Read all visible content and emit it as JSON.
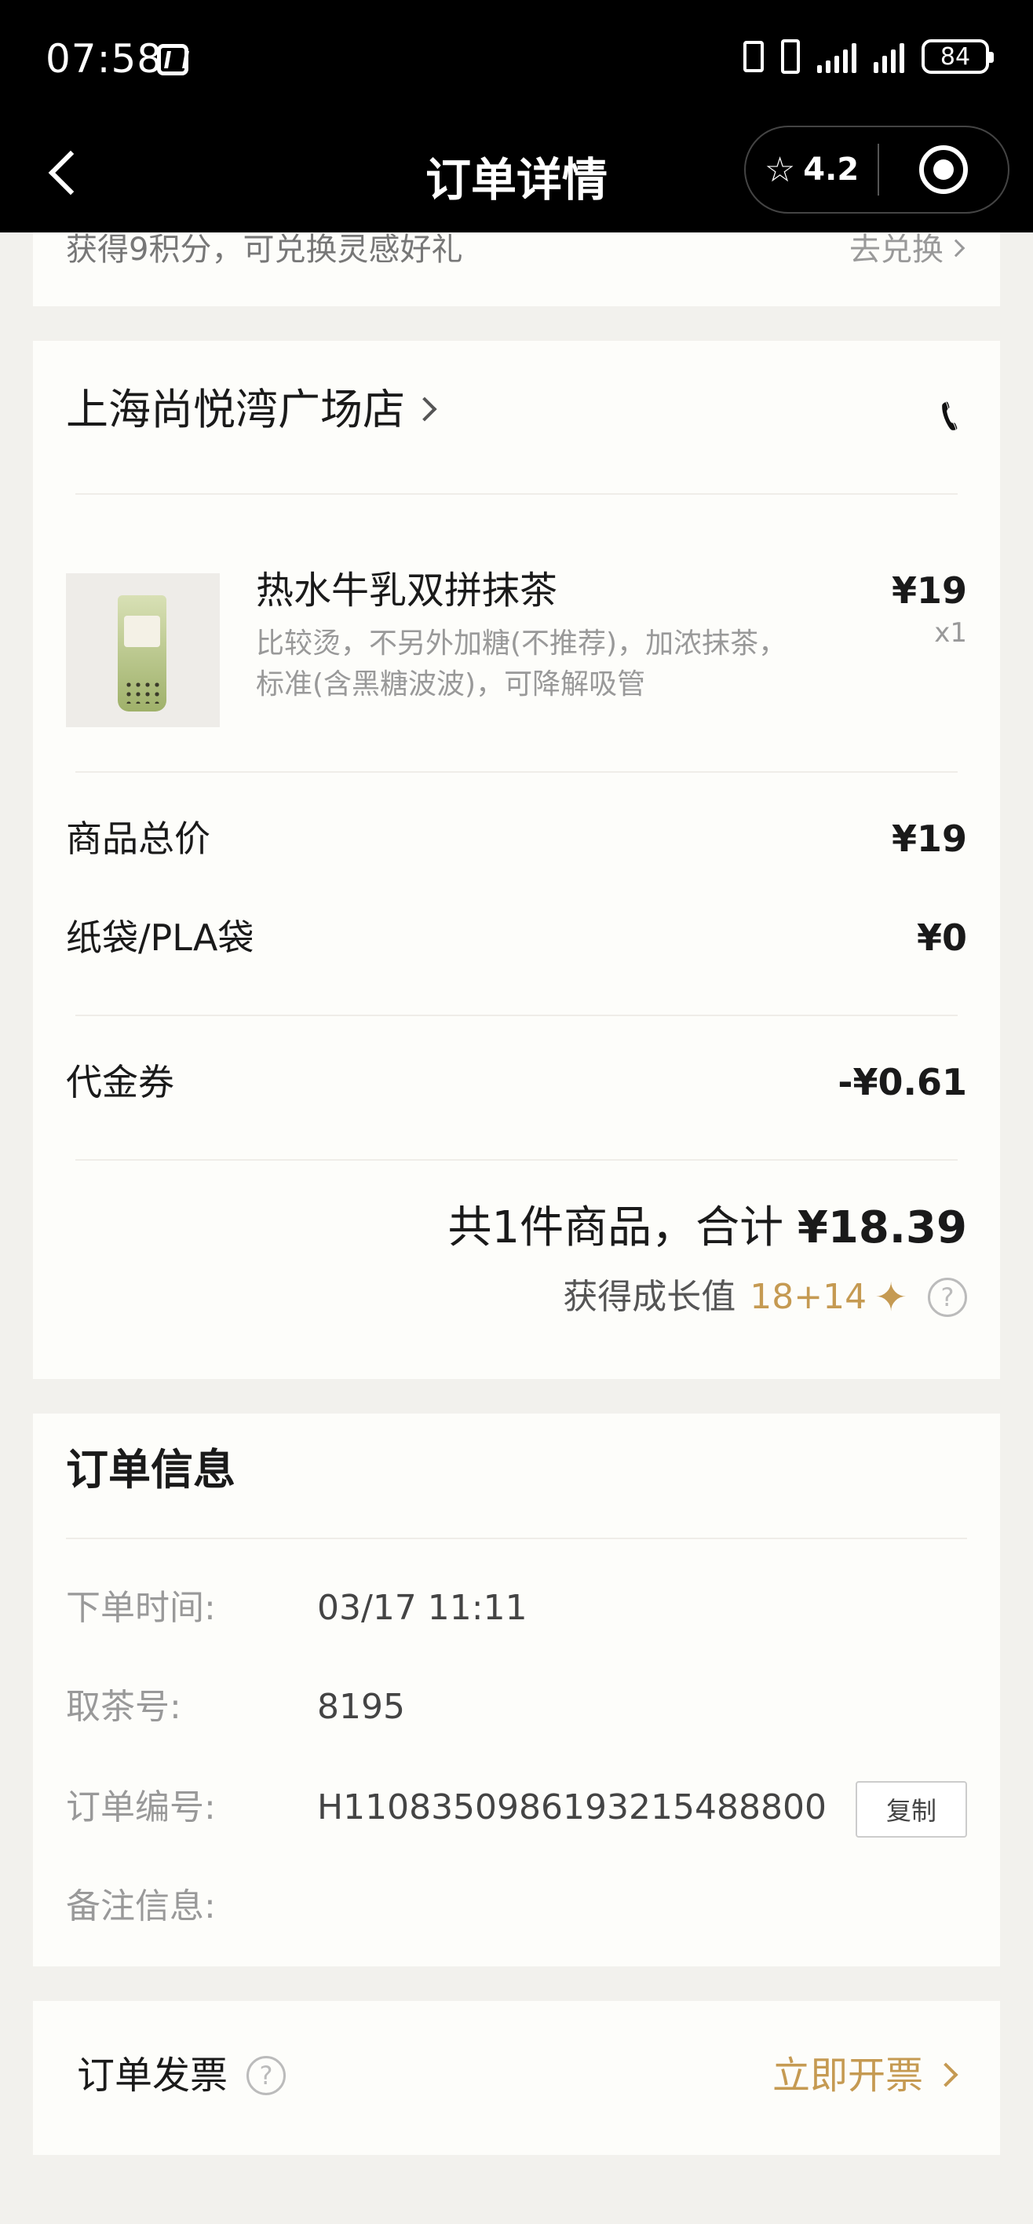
{
  "status_bar": {
    "time": "07:58",
    "battery": "84"
  },
  "header": {
    "title": "订单详情",
    "rating": "4.2"
  },
  "points_card": {
    "text": "获得9积分，可兑换灵感好礼",
    "action": "去兑换"
  },
  "order_card": {
    "store_name": "上海尚悦湾广场店",
    "product": {
      "name": "热水牛乳双拼抹茶",
      "options": "比较烫，不另外加糖(不推荐)，加浓抹茶，标准(含黑糖波波)，可降解吸管",
      "price": "¥19",
      "quantity": "x1"
    },
    "summary": [
      {
        "label": "商品总价",
        "value": "¥19"
      },
      {
        "label": "纸袋/PLA袋",
        "value": "¥0"
      },
      {
        "label": "代金券",
        "value": "-¥0.61"
      }
    ],
    "total_prefix": "共1件商品，合计",
    "total_amount": "¥18.39",
    "growth_label": "获得成长值",
    "growth_value": "18+14"
  },
  "info_card": {
    "title": "订单信息",
    "rows": [
      {
        "key": "下单时间:",
        "value": "03/17 11:11"
      },
      {
        "key": "取茶号:",
        "value": "8195"
      },
      {
        "key": "订单编号:",
        "value": "H1108350986193215488800"
      },
      {
        "key": "备注信息:",
        "value": ""
      }
    ],
    "copy_label": "复制"
  },
  "invoice_card": {
    "label": "订单发票",
    "action": "立即开票"
  },
  "colors": {
    "accent_gold": "#c59a52",
    "header_bg": "#000000",
    "page_bg": "#f2f1ed"
  }
}
